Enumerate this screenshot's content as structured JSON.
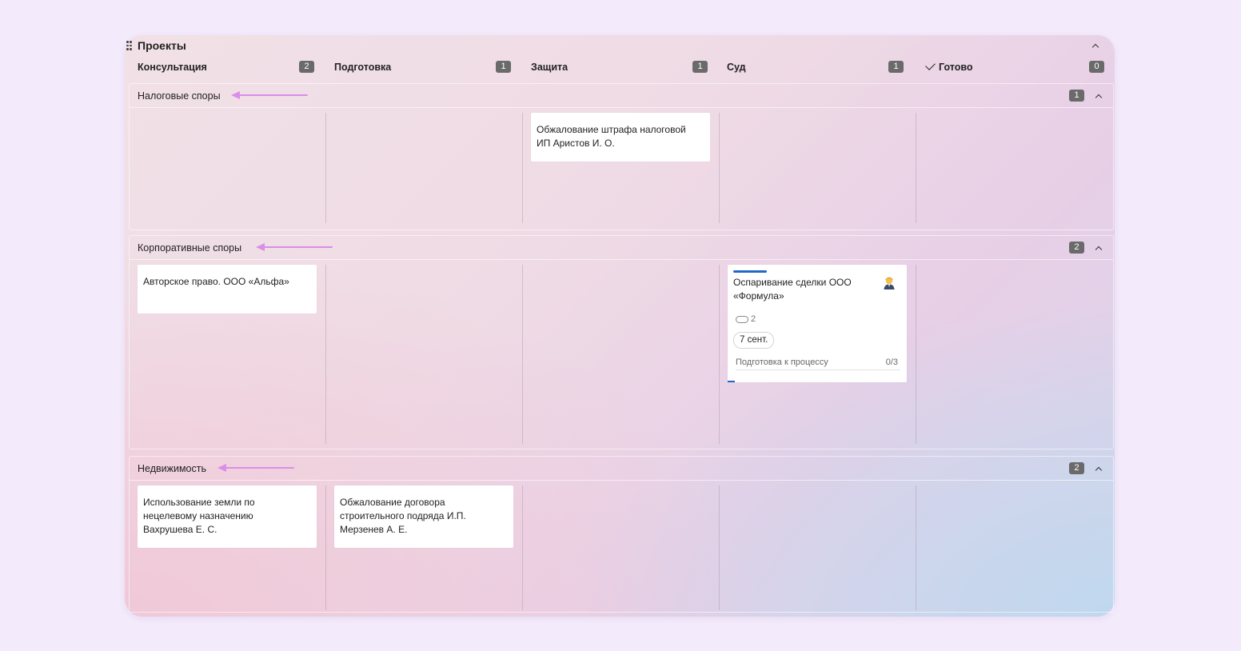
{
  "board": {
    "title": "Проекты",
    "columns": [
      {
        "name": "Консультация",
        "count": "2"
      },
      {
        "name": "Подготовка",
        "count": "1"
      },
      {
        "name": "Защита",
        "count": "1"
      },
      {
        "name": "Суд",
        "count": "1"
      },
      {
        "name": "Готово",
        "count": "0"
      }
    ]
  },
  "groups": [
    {
      "title": "Налоговые споры",
      "count": "1",
      "cards": [
        {
          "text": "Обжалование штрафа налоговой ИП Аристов И. О."
        }
      ]
    },
    {
      "title": "Корпоративные споры",
      "count": "2",
      "cards": [
        {
          "text": "Авторское право. ООО «Альфа»"
        },
        {
          "text": "Оспаривание сделки ООО «Формула»",
          "attachments": "2",
          "date": "7 сент.",
          "checklist": "Подготовка к процессу",
          "checklist_count": "0/3"
        }
      ]
    },
    {
      "title": "Недвижимость",
      "count": "2",
      "cards": [
        {
          "text": "Использование земли по нецелевому назначению Вахрушева Е. С."
        },
        {
          "text": "Обжалование договора строительного подряда И.П. Мерзенев А. Е."
        }
      ]
    }
  ],
  "colors": {
    "arrow": "#d98ee8",
    "accent": "#2268c9",
    "badge": "#6a6a6a"
  },
  "icons": [
    "drag-handle-icon",
    "chevron-up-icon",
    "check-icon",
    "arrow-left-icon",
    "user-avatar-icon",
    "paperclip-icon"
  ]
}
